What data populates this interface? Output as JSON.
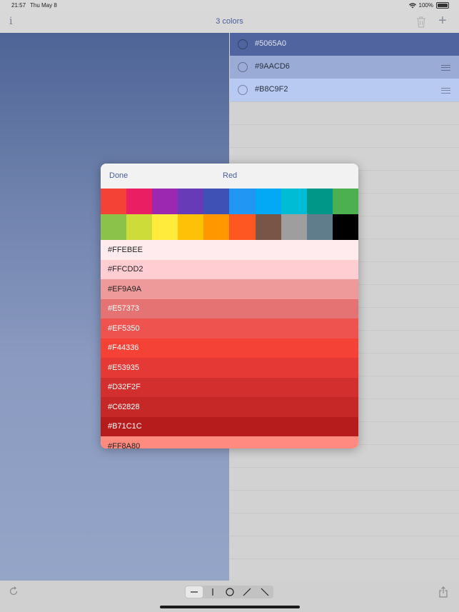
{
  "status_bar": {
    "time": "21:57",
    "day": "Thu May 8",
    "battery": "100%"
  },
  "toolbar": {
    "info_icon": "info-icon",
    "title": "3 colors",
    "trash_icon": "trash-icon",
    "add_icon": "plus-icon"
  },
  "colors": [
    {
      "hex": "#5065A0",
      "text_color": "#dfe4f0"
    },
    {
      "hex": "#9AACD6",
      "text_color": "#2b3040"
    },
    {
      "hex": "#B8C9F2",
      "text_color": "#2b3040"
    }
  ],
  "bottom_bar": {
    "refresh_icon": "refresh-icon",
    "share_icon": "share-icon",
    "segments": [
      {
        "icon": "horizontal-line-icon"
      },
      {
        "icon": "vertical-line-icon"
      },
      {
        "icon": "circle-icon"
      },
      {
        "icon": "diagonal-up-icon"
      },
      {
        "icon": "diagonal-down-icon"
      }
    ]
  },
  "popover": {
    "done_label": "Done",
    "selected_name": "Red",
    "palette": [
      "#F44336",
      "#E91E63",
      "#9C27B0",
      "#673AB7",
      "#3F51B5",
      "#2196F3",
      "#03A9F4",
      "#00BCD4",
      "#009688",
      "#4CAF50",
      "#8BC34A",
      "#CDDC39",
      "#FFEB3B",
      "#FFC107",
      "#FF9800",
      "#FF5722",
      "#795548",
      "#9E9E9E",
      "#607D8B",
      "#000000"
    ],
    "shades": [
      {
        "hex": "#FFEBEE",
        "text_color": "#222222"
      },
      {
        "hex": "#FFCDD2",
        "text_color": "#222222"
      },
      {
        "hex": "#EF9A9A",
        "text_color": "#222222"
      },
      {
        "hex": "#E57373",
        "text_color": "#ffffff"
      },
      {
        "hex": "#EF5350",
        "text_color": "#ffffff"
      },
      {
        "hex": "#F44336",
        "text_color": "#ffffff"
      },
      {
        "hex": "#E53935",
        "text_color": "#ffffff"
      },
      {
        "hex": "#D32F2F",
        "text_color": "#ffffff"
      },
      {
        "hex": "#C62828",
        "text_color": "#ffffff"
      },
      {
        "hex": "#B71C1C",
        "text_color": "#ffffff"
      },
      {
        "hex": "#FF8A80",
        "text_color": "#222222"
      }
    ]
  }
}
